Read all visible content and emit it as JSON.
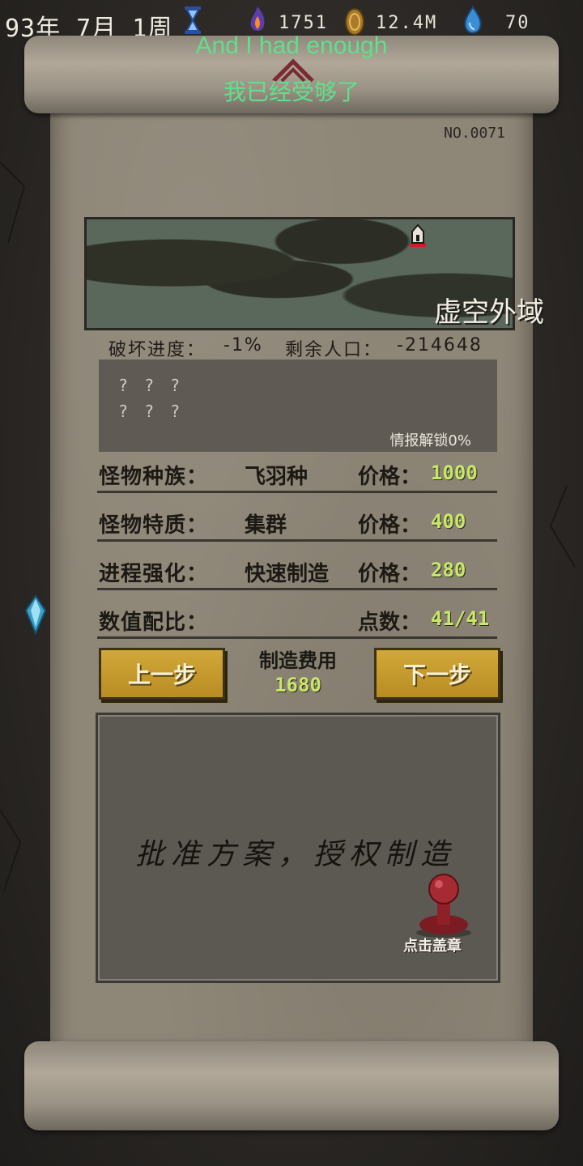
{
  "topbar": {
    "date": "93年 7月 1周",
    "resources": [
      {
        "icon": "flame-icon",
        "value": "1751"
      },
      {
        "icon": "coin-icon",
        "value": "12.4M"
      },
      {
        "icon": "water-drop-icon",
        "value": "70"
      }
    ]
  },
  "subtitles": {
    "english": "And I had enough",
    "chinese": "我已经受够了"
  },
  "card": {
    "number": "NO.0071",
    "region": "虚空外域",
    "destruction_label": "破坏进度：",
    "destruction_value": "-1%",
    "population_label": "剩余人口：",
    "population_value": "-214648",
    "intel_line1": "? ? ?",
    "intel_line2": "? ? ?",
    "intel_unlock": "情报解锁0%"
  },
  "rows": [
    {
      "label": "怪物种族：",
      "value": "飞羽种",
      "price_label": "价格：",
      "price": "1000"
    },
    {
      "label": "怪物特质：",
      "value": "集群",
      "price_label": "价格：",
      "price": "400"
    },
    {
      "label": "进程强化：",
      "value": "快速制造",
      "price_label": "价格：",
      "price": "280"
    },
    {
      "label": "数值配比：",
      "value": "",
      "price_label": "点数：",
      "price": "41/41"
    }
  ],
  "actions": {
    "prev": "上一步",
    "next": "下一步",
    "cost_label": "制造费用",
    "cost_value": "1680"
  },
  "approval": {
    "text": "批准方案，授权制造",
    "stamp_label": "点击盖章"
  },
  "colors": {
    "accent_green": "#c8e66a",
    "subtitle_green": "#5fe08c",
    "button_gold": "#c79a2c"
  }
}
